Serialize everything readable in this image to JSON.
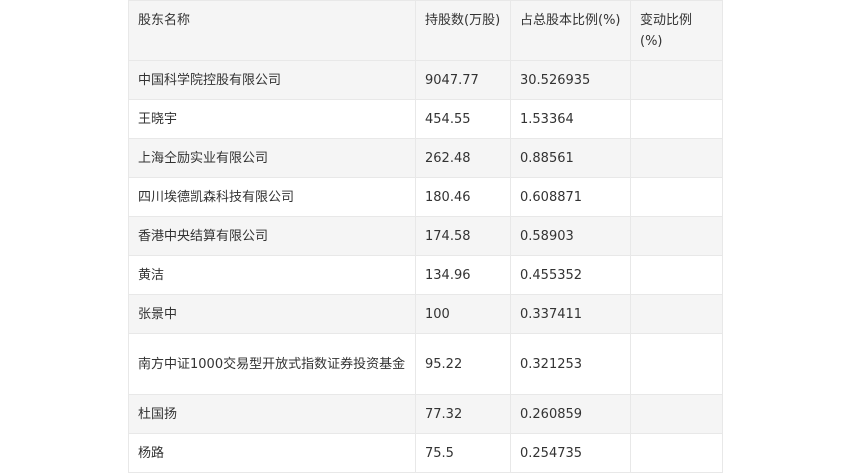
{
  "table": {
    "headers": {
      "name": "股东名称",
      "shares": "持股数(万股)",
      "pct": "占总股本比例(%)",
      "change": "变动比例(%)"
    },
    "rows": [
      {
        "name": "中国科学院控股有限公司",
        "shares": "9047.77",
        "pct": "30.526935",
        "change": ""
      },
      {
        "name": "王晓宇",
        "shares": "454.55",
        "pct": "1.53364",
        "change": ""
      },
      {
        "name": "上海仝励实业有限公司",
        "shares": "262.48",
        "pct": "0.88561",
        "change": ""
      },
      {
        "name": "四川埃德凯森科技有限公司",
        "shares": "180.46",
        "pct": "0.608871",
        "change": ""
      },
      {
        "name": "香港中央结算有限公司",
        "shares": "174.58",
        "pct": "0.58903",
        "change": ""
      },
      {
        "name": "黄洁",
        "shares": "134.96",
        "pct": "0.455352",
        "change": ""
      },
      {
        "name": "张景中",
        "shares": "100",
        "pct": "0.337411",
        "change": ""
      },
      {
        "name": "南方中证1000交易型开放式指数证券投资基金",
        "shares": "95.22",
        "pct": "0.321253",
        "change": ""
      },
      {
        "name": "杜国扬",
        "shares": "77.32",
        "pct": "0.260859",
        "change": ""
      },
      {
        "name": "杨路",
        "shares": "75.5",
        "pct": "0.254735",
        "change": ""
      }
    ]
  }
}
